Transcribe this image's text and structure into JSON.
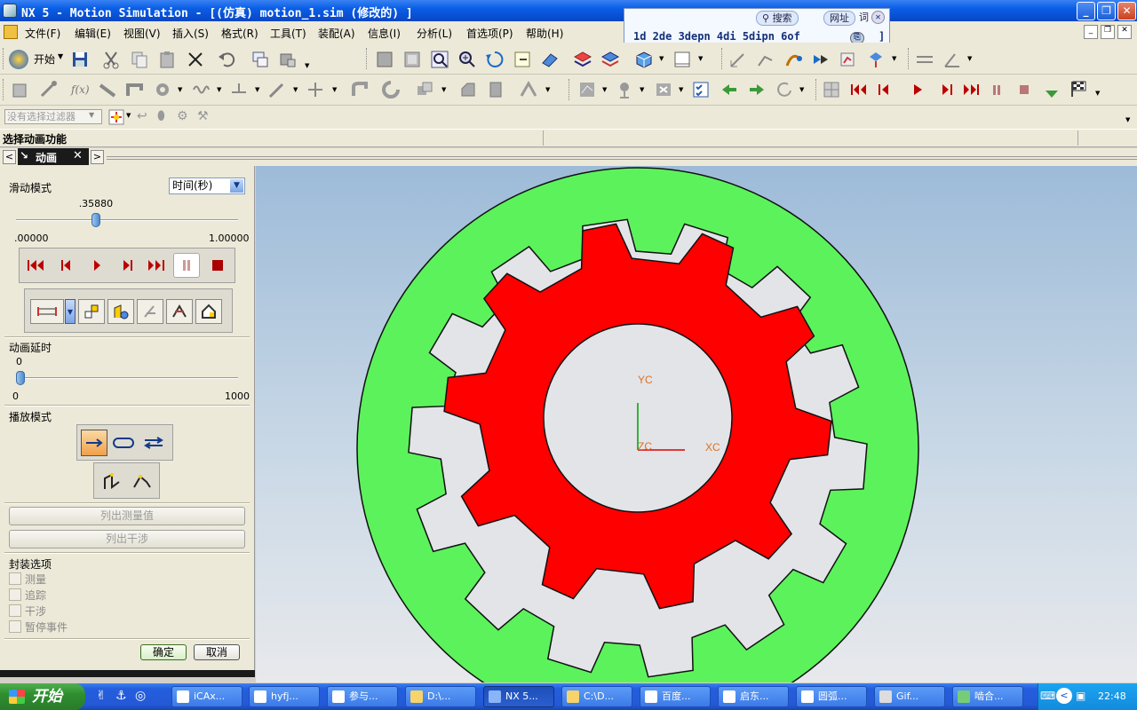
{
  "window": {
    "title": "NX 5 - Motion Simulation - [(仿真) motion_1.sim  (修改的) ]"
  },
  "popup": {
    "search_label": "搜索",
    "address_label": "网址",
    "dict_label": "词",
    "text": "1d 2de 3depn 4di 5dipn 6of",
    "suffix": "]"
  },
  "menu": [
    {
      "label": "文件(F)"
    },
    {
      "label": "编辑(E)"
    },
    {
      "label": "视图(V)"
    },
    {
      "label": "插入(S)"
    },
    {
      "label": "格式(R)"
    },
    {
      "label": "工具(T)"
    },
    {
      "label": "装配(A)"
    },
    {
      "label": "信息(I)"
    },
    {
      "label": "分析(L)"
    },
    {
      "label": "首选项(P)"
    },
    {
      "label": "帮助(H)"
    }
  ],
  "toolbar": {
    "start_label": "开始",
    "fx_label": "f(x)"
  },
  "filter": {
    "placeholder": "没有选择过滤器"
  },
  "status": {
    "text": "选择动画功能"
  },
  "tab": {
    "label": "动画"
  },
  "panel": {
    "slide_mode_label": "滑动模式",
    "time_mode_value": "时间(秒)",
    "slider_value": ".35880",
    "slider_fraction": 0.3588,
    "slider_min": ".00000",
    "slider_max": "1.00000",
    "delay_label": "动画延时",
    "delay_value": "0",
    "delay_min": "0",
    "delay_max": "1000",
    "play_mode_label": "播放模式",
    "list_measure_button": "列出测量值",
    "list_interference_button": "列出干涉",
    "package_options_label": "封装选项",
    "options": [
      {
        "label": "测量",
        "checked": false
      },
      {
        "label": "追踪",
        "checked": false
      },
      {
        "label": "干涉",
        "checked": false
      },
      {
        "label": "暂停事件",
        "checked": false
      }
    ],
    "ok_button": "确定",
    "cancel_button": "取消"
  },
  "viewport": {
    "axis_yc": "YC",
    "axis_zc": "ZC",
    "axis_xc": "XC",
    "colors": {
      "outer_gear": "#5cf25c",
      "inner_gear": "#ff0000",
      "background_top": "#9dbbd8",
      "background_bottom": "#e8e9ec"
    }
  },
  "taskbar": {
    "start_label": "开始",
    "tasks": [
      {
        "label": "iCAx..."
      },
      {
        "label": "hyfj..."
      },
      {
        "label": "参与..."
      },
      {
        "label": "D:\\..."
      },
      {
        "label": "NX 5..."
      },
      {
        "label": "C:\\D..."
      },
      {
        "label": "百度..."
      },
      {
        "label": "启东..."
      },
      {
        "label": "圆弧..."
      },
      {
        "label": "Gif..."
      },
      {
        "label": "啮合..."
      }
    ],
    "clock": "22:48"
  }
}
